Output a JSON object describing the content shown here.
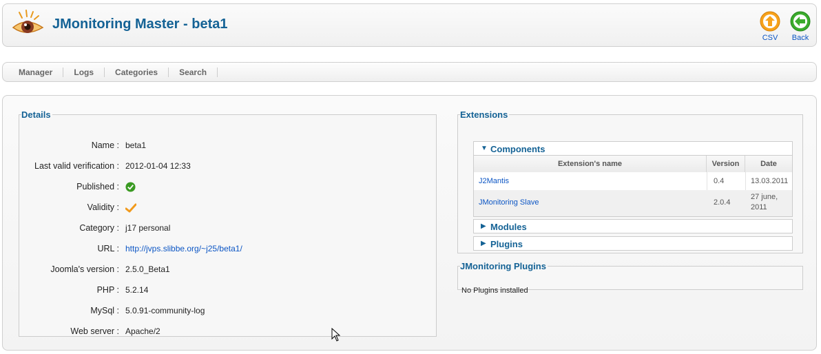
{
  "header": {
    "title": "JMonitoring Master - beta1",
    "csv_label": "CSV",
    "back_label": "Back"
  },
  "submenu": {
    "items": [
      "Manager",
      "Logs",
      "Categories",
      "Search"
    ]
  },
  "details": {
    "legend": "Details",
    "rows": [
      {
        "label": "Name :",
        "value": "beta1"
      },
      {
        "label": "Last valid verification :",
        "value": "2012-01-04 12:33"
      },
      {
        "label": "Published :",
        "icon": "check-circle-icon"
      },
      {
        "label": "Validity :",
        "icon": "checkmark-icon"
      },
      {
        "label": "Category :",
        "value": "j17 personal"
      },
      {
        "label": "URL :",
        "value": "http://jvps.slibbe.org/~j25/beta1/"
      },
      {
        "label": "Joomla's version :",
        "value": "2.5.0_Beta1"
      },
      {
        "label": "PHP :",
        "value": "5.2.14"
      },
      {
        "label": "MySql :",
        "value": "5.0.91-community-log"
      },
      {
        "label": "Web server :",
        "value": "Apache/2"
      }
    ]
  },
  "extensions": {
    "legend": "Extensions",
    "components": {
      "label": "Components",
      "columns": [
        "Extension's name",
        "Version",
        "Date"
      ],
      "rows": [
        {
          "name": "J2Mantis",
          "version": "0.4",
          "date": "13.03.2011"
        },
        {
          "name": "JMonitoring Slave",
          "version": "2.0.4",
          "date_line1": "27 june,",
          "date_line2": "2011"
        }
      ]
    },
    "modules_label": "Modules",
    "plugins_label": "Plugins"
  },
  "jm_plugins": {
    "legend": "JMonitoring Plugins",
    "message": "No Plugins installed"
  },
  "colors": {
    "title_blue": "#146295",
    "link_blue": "#0b55c4",
    "csv_orange": "#f7a21b",
    "back_green": "#3bab2c"
  }
}
